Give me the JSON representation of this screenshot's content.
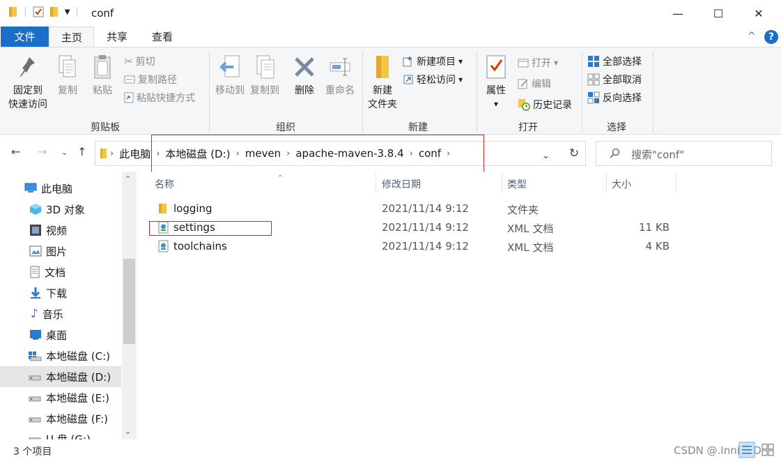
{
  "window": {
    "title": "conf",
    "minimize_glyph": "—",
    "maximize_glyph": "☐",
    "close_glyph": "✕"
  },
  "ribbon_tabs": {
    "file": "文件",
    "home": "主页",
    "share": "共享",
    "view": "查看",
    "collapse_glyph": "^",
    "help_glyph": "?"
  },
  "ribbon": {
    "clipboard": {
      "label": "剪贴板",
      "pin_line1": "固定到",
      "pin_line2": "快速访问",
      "copy": "复制",
      "paste": "粘贴",
      "cut": "剪切",
      "copy_path": "复制路径",
      "paste_shortcut": "粘贴快捷方式"
    },
    "organize": {
      "label": "组织",
      "move_to": "移动到",
      "copy_to": "复制到",
      "delete": "删除",
      "rename": "重命名"
    },
    "new": {
      "label": "新建",
      "new_folder_line1": "新建",
      "new_folder_line2": "文件夹",
      "new_item": "新建项目",
      "easy_access": "轻松访问"
    },
    "open": {
      "label": "打开",
      "properties": "属性",
      "open": "打开",
      "edit": "编辑",
      "history": "历史记录"
    },
    "select": {
      "label": "选择",
      "select_all": "全部选择",
      "select_none": "全部取消",
      "invert": "反向选择"
    }
  },
  "address": {
    "crumbs": [
      "此电脑",
      "本地磁盘 (D:)",
      "meven",
      "apache-maven-3.8.4",
      "conf"
    ],
    "search_placeholder": "搜索\"conf\""
  },
  "sidebar": {
    "items": [
      {
        "label": "此电脑",
        "icon": "computer-icon"
      },
      {
        "label": "3D 对象",
        "icon": "cube-icon"
      },
      {
        "label": "视频",
        "icon": "video-icon"
      },
      {
        "label": "图片",
        "icon": "picture-icon"
      },
      {
        "label": "文档",
        "icon": "document-icon"
      },
      {
        "label": "下载",
        "icon": "download-icon"
      },
      {
        "label": "音乐",
        "icon": "music-icon"
      },
      {
        "label": "桌面",
        "icon": "desktop-icon"
      },
      {
        "label": "本地磁盘 (C:)",
        "icon": "drive-icon"
      },
      {
        "label": "本地磁盘 (D:)",
        "icon": "drive-icon",
        "selected": true
      },
      {
        "label": "本地磁盘 (E:)",
        "icon": "drive-icon"
      },
      {
        "label": "本地磁盘 (F:)",
        "icon": "drive-icon"
      },
      {
        "label": "U 盘 (G:)",
        "icon": "usb-drive-icon"
      }
    ]
  },
  "file_list": {
    "columns": [
      "名称",
      "修改日期",
      "类型",
      "大小"
    ],
    "rows": [
      {
        "name": "logging",
        "date": "2021/11/14 9:12",
        "type": "文件夹",
        "size": "",
        "icon": "folder-icon"
      },
      {
        "name": "settings",
        "date": "2021/11/14 9:12",
        "type": "XML 文档",
        "size": "11 KB",
        "icon": "xml-file-icon"
      },
      {
        "name": "toolchains",
        "date": "2021/11/14 9:12",
        "type": "XML 文档",
        "size": "4 KB",
        "icon": "xml-file-icon"
      }
    ]
  },
  "status": {
    "count": "3 个项目",
    "watermark": "CSDN @.InnisDD"
  },
  "colors": {
    "accent": "#1a6ec7",
    "highlight_box": "#e02020",
    "folder": "#f4c542"
  }
}
